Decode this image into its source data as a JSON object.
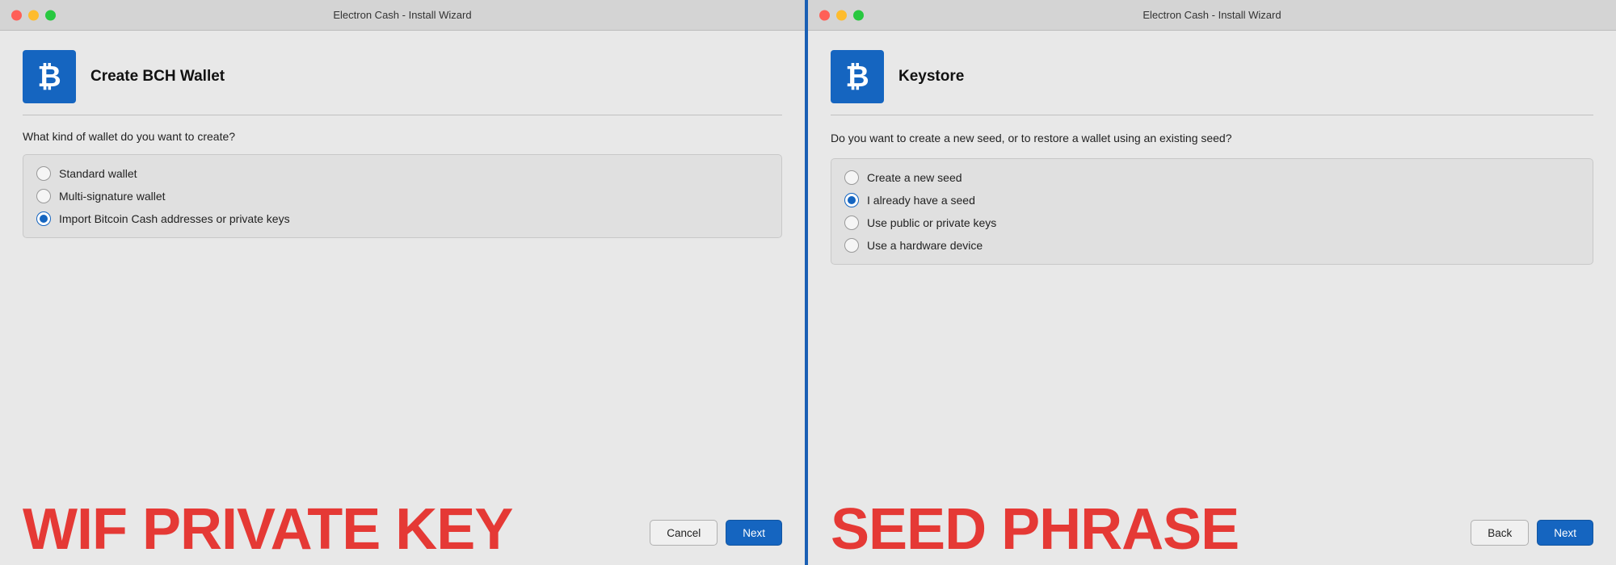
{
  "panel_left": {
    "titlebar": "Electron Cash  -  Install Wizard",
    "controls": {
      "close": "close",
      "minimize": "minimize",
      "maximize": "maximize"
    },
    "icon_symbol": "₿",
    "title": "Create BCH Wallet",
    "question": "What kind of wallet do you want to create?",
    "options": [
      {
        "id": "standard",
        "label": "Standard wallet",
        "selected": false
      },
      {
        "id": "multisig",
        "label": "Multi-signature wallet",
        "selected": false
      },
      {
        "id": "import",
        "label": "Import Bitcoin Cash addresses or private keys",
        "selected": true
      }
    ],
    "bottom_label": "WIF PRIVATE KEY",
    "cancel_label": "Cancel",
    "next_label": "Next"
  },
  "panel_right": {
    "titlebar": "Electron Cash  -  Install Wizard",
    "controls": {
      "close": "close",
      "minimize": "minimize",
      "maximize": "maximize"
    },
    "icon_symbol": "₿",
    "title": "Keystore",
    "description": "Do you want to create a new seed, or to restore a wallet using an existing seed?",
    "options": [
      {
        "id": "new-seed",
        "label": "Create a new seed",
        "selected": false
      },
      {
        "id": "existing-seed",
        "label": "I already have a seed",
        "selected": true
      },
      {
        "id": "keys",
        "label": "Use public or private keys",
        "selected": false
      },
      {
        "id": "hardware",
        "label": "Use a hardware device",
        "selected": false
      }
    ],
    "bottom_label": "SEED PHRASE",
    "back_label": "Back",
    "next_label": "Next"
  }
}
